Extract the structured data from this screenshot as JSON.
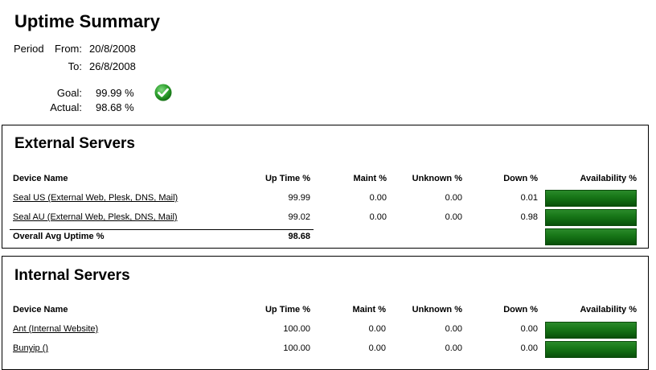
{
  "title": "Uptime Summary",
  "period": {
    "label": "Period",
    "from_label": "From:",
    "from_value": "20/8/2008",
    "to_label": "To:",
    "to_value": "26/8/2008"
  },
  "goal": {
    "label": "Goal:",
    "value": "99.99 %"
  },
  "actual": {
    "label": "Actual:",
    "value": "98.68 %"
  },
  "status_icon": "green-check-icon",
  "columns": {
    "device": "Device Name",
    "uptime_ext": "Up Time %",
    "uptime_int": "Up  Time %",
    "maint_ext": "Maint %",
    "maint_int": "Maint  %",
    "unknown": "Unknown %",
    "down": "Down %",
    "availability": "Availability %"
  },
  "external": {
    "title": "External Servers",
    "rows": [
      {
        "name": "Seal US (External Web, Plesk, DNS, Mail)",
        "uptime": "99.99",
        "maint": "0.00",
        "unknown": "0.00",
        "down": "0.01",
        "availability": 99.99
      },
      {
        "name": "Seal AU (External Web, Plesk, DNS, Mail)",
        "uptime": "99.02",
        "maint": "0.00",
        "unknown": "0.00",
        "down": "0.98",
        "availability": 99.02
      }
    ],
    "overall_label": "Overall Avg Uptime %",
    "overall_value": "98.68",
    "overall_availability": 98.68
  },
  "internal": {
    "title": "Internal Servers",
    "rows": [
      {
        "name": "Ant (Internal Website)",
        "uptime": "100.00",
        "maint": "0.00",
        "unknown": "0.00",
        "down": "0.00",
        "availability": 100
      },
      {
        "name": "Bunyip ()",
        "uptime": "100.00",
        "maint": "0.00",
        "unknown": "0.00",
        "down": "0.00",
        "availability": 100
      }
    ]
  },
  "colors": {
    "bar_green": "#1a7a1a",
    "check_green": "#2ea02e"
  }
}
